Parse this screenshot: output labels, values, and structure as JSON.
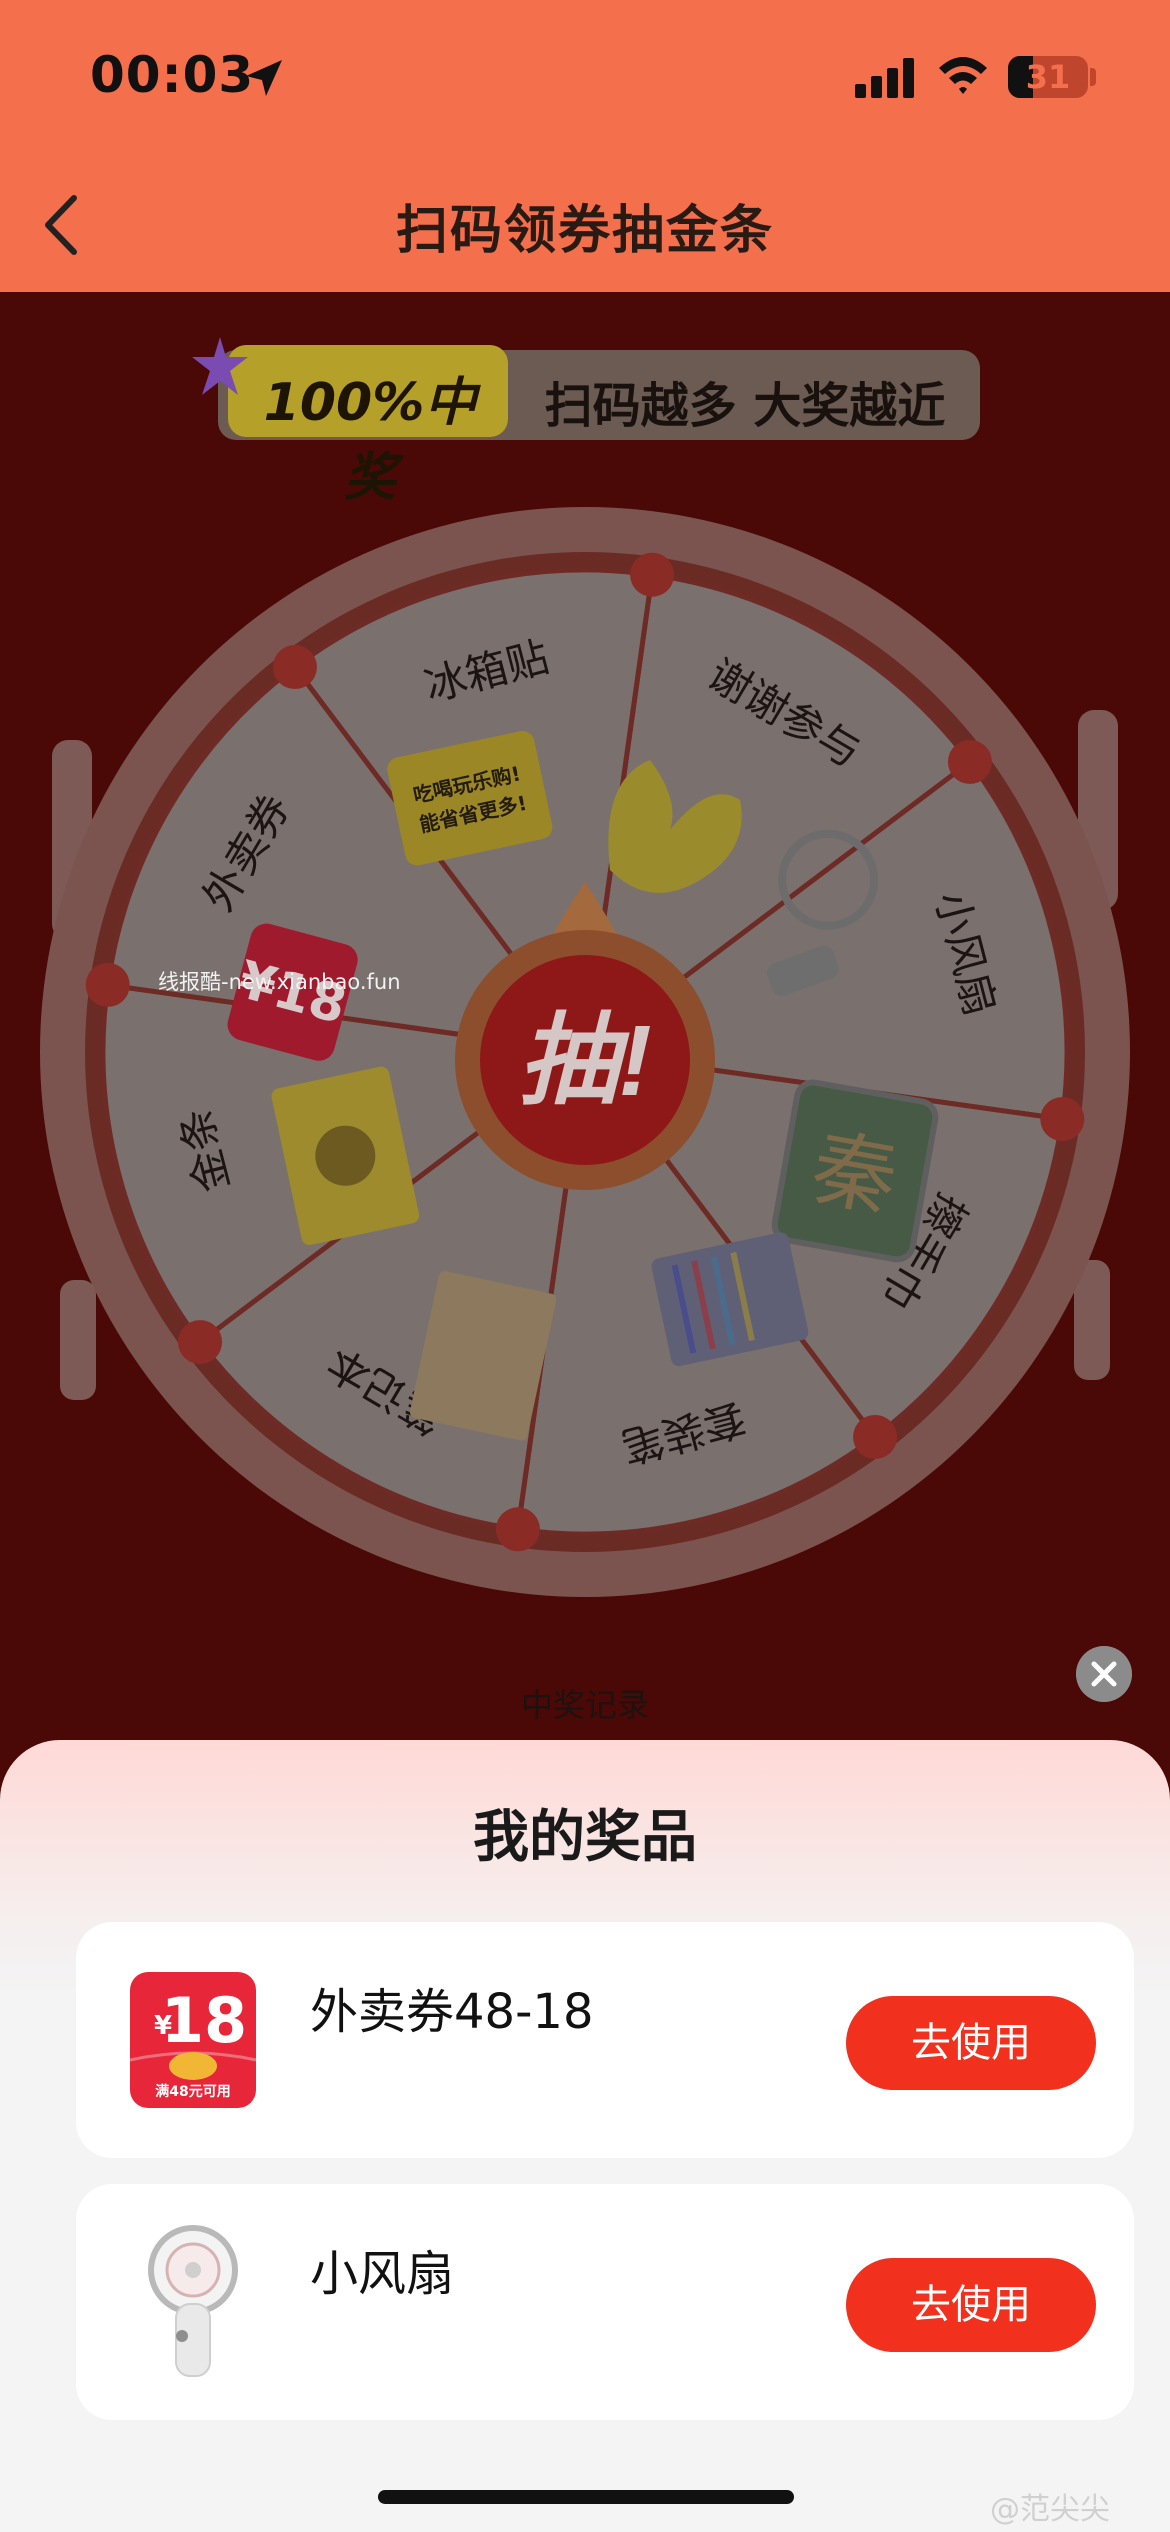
{
  "status_bar": {
    "time": "00:03",
    "battery": "31",
    "battery_level": 0.31
  },
  "nav": {
    "title": "扫码领券抽金条"
  },
  "banner": {
    "left_text": "100%中奖",
    "right_text": "扫码越多 大奖越近"
  },
  "wheel": {
    "center_label": "抽!",
    "segments": [
      {
        "label": "谢谢参与"
      },
      {
        "label": "小风扇"
      },
      {
        "label": "擦手巾"
      },
      {
        "label": "套装笔"
      },
      {
        "label": "笔记本"
      },
      {
        "label": "金条"
      },
      {
        "label": "外卖券"
      },
      {
        "label": "冰箱贴"
      }
    ],
    "sticker_text": [
      "吃喝玩乐购!",
      "能省省更多!"
    ],
    "coupon_small": "¥18"
  },
  "watermark": "线报酷-new.xianbao.fun",
  "record_link": "中奖记录",
  "sheet": {
    "title": "我的奖品",
    "prizes": [
      {
        "name": "外卖券48-18",
        "button": "去使用",
        "coupon_amount": "18",
        "coupon_currency": "¥",
        "coupon_cond": "满48元可用"
      },
      {
        "name": "小风扇",
        "button": "去使用"
      }
    ]
  },
  "weibo": "@范尖尖",
  "colors": {
    "accent": "#f1301e",
    "header": "#f46f4c",
    "overlay_bg": "#4a0906"
  }
}
